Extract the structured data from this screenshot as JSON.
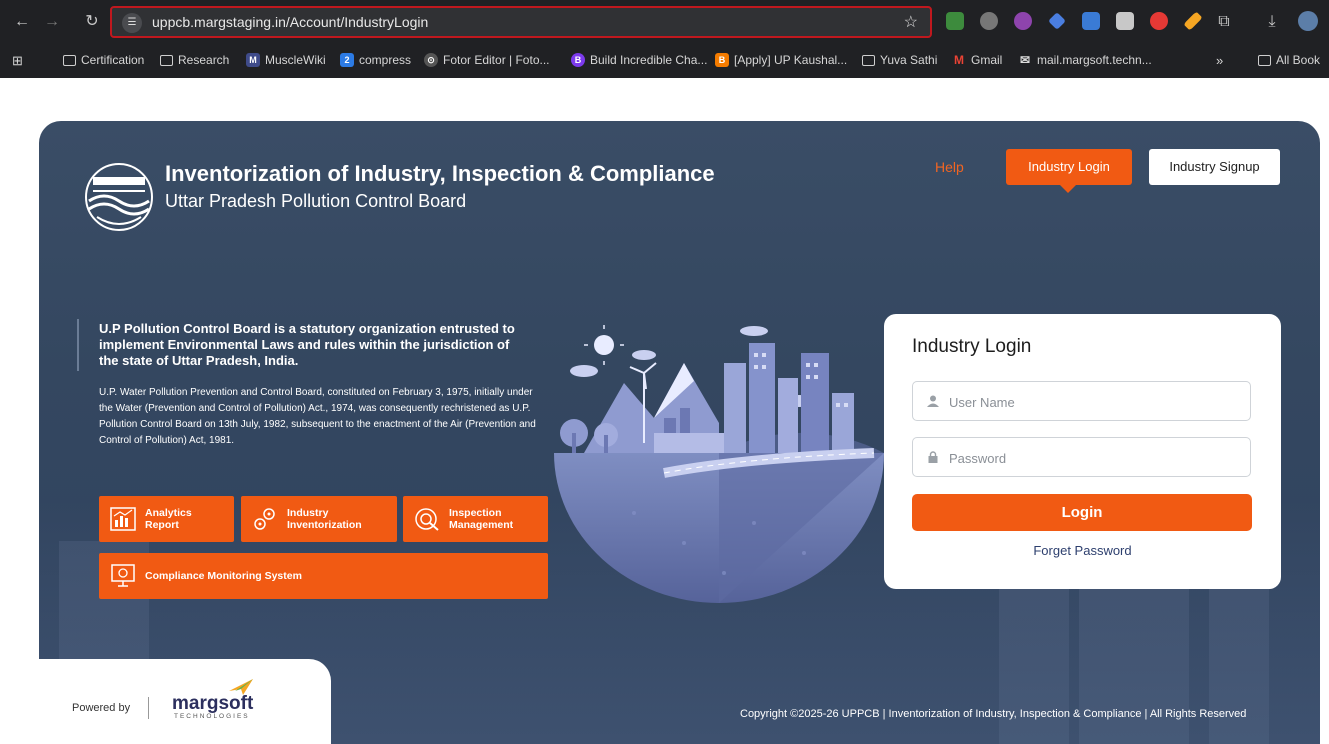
{
  "browser": {
    "url": "uppcb.margstaging.in/Account/IndustryLogin",
    "bookmarks": [
      {
        "label": "Certification",
        "icon": "folder-icon"
      },
      {
        "label": "Research",
        "icon": "folder-icon"
      },
      {
        "label": "MuscleWiki",
        "icon": "musclewiki-icon"
      },
      {
        "label": "compress",
        "icon": "compress-icon"
      },
      {
        "label": "Fotor Editor | Foto...",
        "icon": "fotor-icon"
      },
      {
        "label": "Build Incredible Cha...",
        "icon": "build-icon"
      },
      {
        "label": "[Apply] UP Kaushal...",
        "icon": "blogger-icon"
      },
      {
        "label": "Yuva Sathi",
        "icon": "folder-icon"
      },
      {
        "label": "Gmail",
        "icon": "gmail-icon"
      },
      {
        "label": "mail.margsoft.techn...",
        "icon": "mail-icon"
      },
      {
        "label": "All Book",
        "icon": "folder-icon"
      }
    ],
    "overflow_label": "»"
  },
  "header": {
    "title": "Inventorization of Industry, Inspection & Compliance",
    "subtitle": "Uttar Pradesh Pollution Control Board",
    "help_label": "Help",
    "login_label": "Industry Login",
    "signup_label": "Industry Signup"
  },
  "intro": {
    "heading": "U.P Pollution Control Board is a statutory organization entrusted to implement Environmental Laws and rules within the jurisdiction of the state of Uttar Pradesh, India.",
    "body": "U.P. Water Pollution Prevention and Control Board, constituted on February 3, 1975, initially under the Water (Prevention and Control of Pollution) Act., 1974, was consequently rechristened as U.P. Pollution Control Board on 13th July, 1982, subsequent to the enactment of the Air (Prevention and Control of Pollution) Act, 1981."
  },
  "tiles": [
    {
      "label": "Analytics\nReport",
      "icon": "analytics-icon"
    },
    {
      "label": "Industry\nInventorization",
      "icon": "gears-icon"
    },
    {
      "label": "Inspection\nManagement",
      "icon": "inspection-icon"
    },
    {
      "label": "Compliance Monitoring System",
      "icon": "monitor-icon"
    }
  ],
  "login_card": {
    "title": "Industry Login",
    "username_placeholder": "User Name",
    "password_placeholder": "Password",
    "submit_label": "Login",
    "forgot_label": "Forget Password"
  },
  "footer": {
    "powered_by": "Powered by",
    "brand": "margsoft",
    "brand_tag": "TECHNOLOGIES",
    "copyright": "Copyright ©2025-26 UPPCB | Inventorization of Industry, Inspection & Compliance | All Rights Reserved"
  },
  "colors": {
    "accent": "#f15a13",
    "panel": "#344760",
    "link": "#2d3f6e"
  }
}
